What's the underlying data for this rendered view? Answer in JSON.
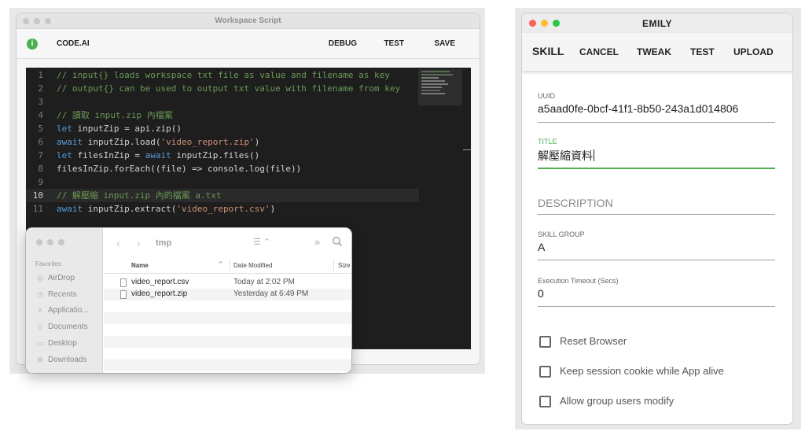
{
  "workspace": {
    "title": "Workspace Script",
    "app_name": "CODE.AI",
    "info_icon": "i",
    "actions": {
      "debug": "DEBUG",
      "test": "TEST",
      "save": "SAVE"
    },
    "code_lines": [
      {
        "n": "1",
        "parts": [
          {
            "t": "// input{} loads workspace txt file as value and filename as key",
            "c": "com"
          }
        ]
      },
      {
        "n": "2",
        "parts": [
          {
            "t": "// output{} can be used to output txt value with filename from key",
            "c": "com"
          }
        ]
      },
      {
        "n": "3",
        "parts": []
      },
      {
        "n": "4",
        "parts": [
          {
            "t": "// 讀取 input.zip 內檔案",
            "c": "com"
          }
        ]
      },
      {
        "n": "5",
        "parts": [
          {
            "t": "let",
            "c": "key"
          },
          {
            "t": " inputZip = api.zip()",
            "c": ""
          }
        ]
      },
      {
        "n": "6",
        "parts": [
          {
            "t": "await",
            "c": "key"
          },
          {
            "t": " inputZip.load(",
            "c": ""
          },
          {
            "t": "'video_report.zip'",
            "c": "str"
          },
          {
            "t": ")",
            "c": ""
          }
        ]
      },
      {
        "n": "7",
        "parts": [
          {
            "t": "let",
            "c": "key"
          },
          {
            "t": " filesInZip = ",
            "c": ""
          },
          {
            "t": "await",
            "c": "key"
          },
          {
            "t": " inputZip.files()",
            "c": ""
          }
        ]
      },
      {
        "n": "8",
        "parts": [
          {
            "t": "filesInZip.forEach((file) => console.log(file))",
            "c": ""
          }
        ]
      },
      {
        "n": "9",
        "parts": []
      },
      {
        "n": "10",
        "parts": [
          {
            "t": "// 解壓縮 input.zip 內的檔案 a.txt",
            "c": "com"
          }
        ],
        "active": true
      },
      {
        "n": "11",
        "parts": [
          {
            "t": "await",
            "c": "key"
          },
          {
            "t": " inputZip.extract(",
            "c": ""
          },
          {
            "t": "'video_report.csv'",
            "c": "str"
          },
          {
            "t": ")",
            "c": ""
          }
        ]
      }
    ]
  },
  "finder": {
    "folder": "tmp",
    "favorites_label": "Favorites",
    "sidebar": [
      {
        "label": "AirDrop",
        "icon": "airdrop-icon",
        "glyph": "◎"
      },
      {
        "label": "Recents",
        "icon": "clock-icon",
        "glyph": "◷"
      },
      {
        "label": "Applicatio...",
        "icon": "applications-icon",
        "glyph": "⋏"
      },
      {
        "label": "Documents",
        "icon": "document-icon",
        "glyph": "▯"
      },
      {
        "label": "Desktop",
        "icon": "desktop-icon",
        "glyph": "▭"
      },
      {
        "label": "Downloads",
        "icon": "download-icon",
        "glyph": "⊕"
      }
    ],
    "columns": {
      "name": "Name",
      "date": "Date Modified",
      "size": "Size"
    },
    "files": [
      {
        "name": "video_report.csv",
        "date": "Today at 2:02 PM"
      },
      {
        "name": "video_report.zip",
        "date": "Yesterday at 6:49 PM"
      }
    ]
  },
  "emily": {
    "title": "EMILY",
    "tabs": {
      "skill": "SKILL",
      "cancel": "CANCEL",
      "tweak": "TWEAK",
      "test": "TEST",
      "upload": "UPLOAD"
    },
    "uuid": {
      "label": "UUID",
      "value": "a5aad0fe-0bcf-41f1-8b50-243a1d014806"
    },
    "title_field": {
      "label": "TITLE",
      "value": "解壓縮資料"
    },
    "description": {
      "placeholder": "DESCRIPTION"
    },
    "skill_group": {
      "label": "SKILL GROUP",
      "value": "A"
    },
    "timeout": {
      "label": "Execution Timeout (Secs)",
      "value": "0"
    },
    "checkboxes": [
      {
        "label": "Reset Browser",
        "checked": false
      },
      {
        "label": "Keep session cookie while App alive",
        "checked": false
      },
      {
        "label": "Allow group users modify",
        "checked": false
      }
    ],
    "accent": "#4caf50"
  }
}
